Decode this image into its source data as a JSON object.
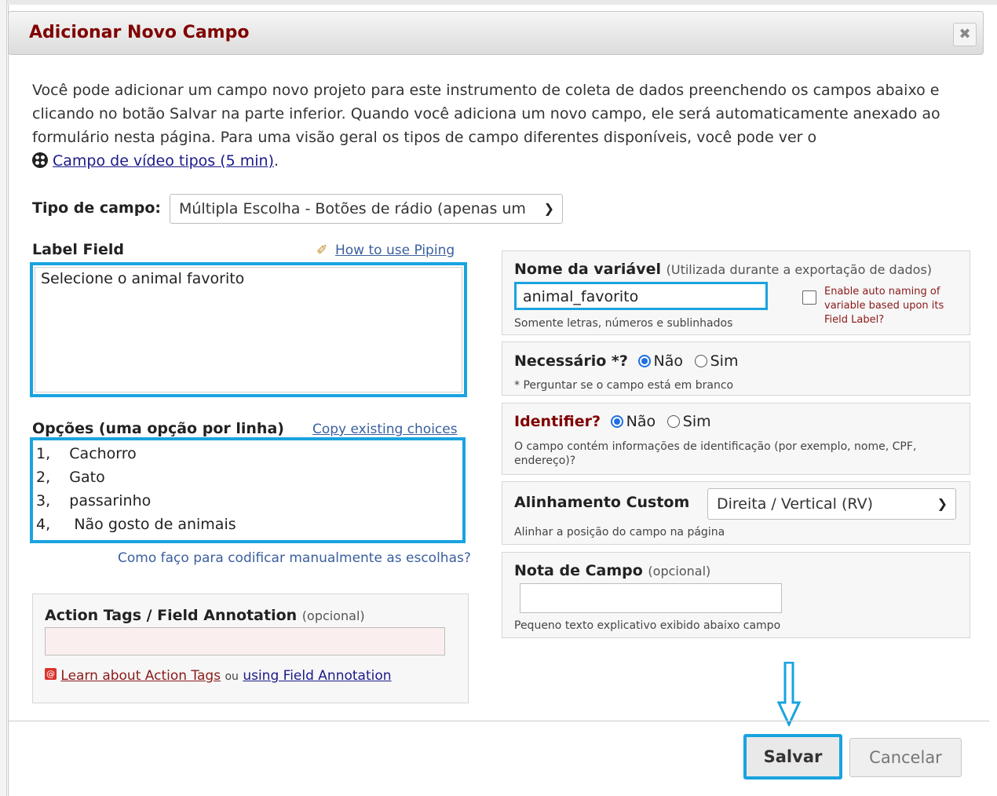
{
  "dialog": {
    "title": "Adicionar Novo Campo",
    "close_label": "✖"
  },
  "intro": {
    "text": "Você pode adicionar um campo novo projeto para este instrumento de coleta de dados preenchendo os campos abaixo e clicando no botão Salvar na parte inferior. Quando você adiciona um novo campo, ele será automaticamente anexado ao formulário nesta página. Para uma visão geral os tipos de campo diferentes disponíveis, você pode ver o",
    "video_link": "Campo de vídeo tipos (5 min)",
    "period": "."
  },
  "field_type": {
    "label": "Tipo de campo:",
    "value": "Múltipla Escolha - Botões de rádio (apenas um"
  },
  "label_field": {
    "label": "Label Field",
    "piping_link": "How to use Piping",
    "value": "Selecione o animal favorito"
  },
  "choices": {
    "label": "Opções (uma opção por linha)",
    "copy_link": "Copy existing choices",
    "lines": [
      "1,    Cachorro",
      "2,    Gato",
      "3,    passarinho",
      "4,     Não gosto de animais"
    ],
    "manual_link": "Como faço para codificar manualmente as escolhas?"
  },
  "action_tags": {
    "label": "Action Tags / Field Annotation",
    "optional": "(opcional)",
    "learn_link": "Learn about Action Tags",
    "or": "ou",
    "annotation_link": "using Field Annotation"
  },
  "variable": {
    "label": "Nome da variável",
    "hint": "(Utilizada durante a exportação de dados)",
    "value": "animal_favorito",
    "help": "Somente letras, números e sublinhados",
    "auto_naming": "Enable auto naming of variable based upon its Field Label?"
  },
  "required": {
    "label": "Necessário *?",
    "no": "Não",
    "yes": "Sim",
    "help": "* Perguntar se o campo está em branco"
  },
  "identifier": {
    "label": "Identifier?",
    "no": "Não",
    "yes": "Sim",
    "help": "O campo contém informações de identificação (por exemplo, nome, CPF, endereço)?"
  },
  "alignment": {
    "label": "Alinhamento Custom",
    "value": "Direita / Vertical (RV)",
    "help": "Alinhar a posição do campo na página"
  },
  "field_note": {
    "label": "Nota de Campo",
    "optional": "(opcional)",
    "help": "Pequeno texto explicativo exibido abaixo campo"
  },
  "footer": {
    "save": "Salvar",
    "cancel": "Cancelar"
  },
  "colors": {
    "title": "#800000",
    "highlight": "#1aa3e0",
    "radio": "#1f6fe0"
  }
}
